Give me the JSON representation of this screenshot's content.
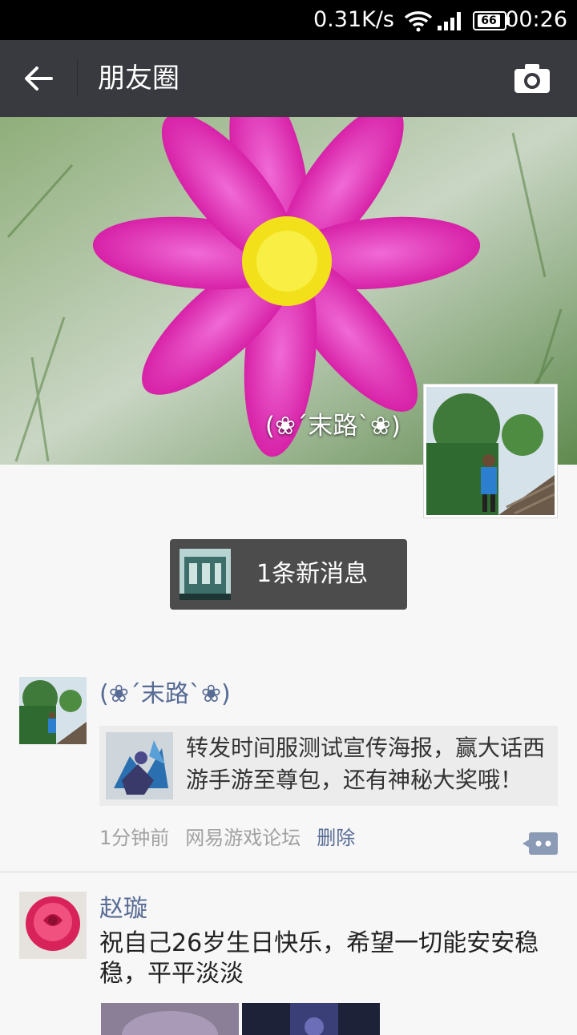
{
  "status_bar": {
    "network_speed": "0.31K/s",
    "battery": "66",
    "time": "00:26"
  },
  "app_bar": {
    "title": "朋友圈",
    "back_icon": "back-arrow-icon",
    "camera_icon": "camera-icon"
  },
  "cover": {
    "user_name": "(❀´末路`❀)"
  },
  "new_message": {
    "label": "1条新消息"
  },
  "feed": [
    {
      "name": "(❀´末路`❀)",
      "share_text": "转发时间服测试宣传海报，赢大话西游手游至尊包，还有神秘大奖哦！",
      "time": "1分钟前",
      "source": "网易游戏论坛",
      "delete_label": "删除",
      "comment_icon": "comment-icon"
    },
    {
      "name": "赵璇",
      "text": "祝自己26岁生日快乐，希望一切能安安稳稳，平平淡淡"
    }
  ],
  "colors": {
    "app_bar": "#393a3f",
    "name_link": "#576b95",
    "background": "#f7f7f7"
  }
}
